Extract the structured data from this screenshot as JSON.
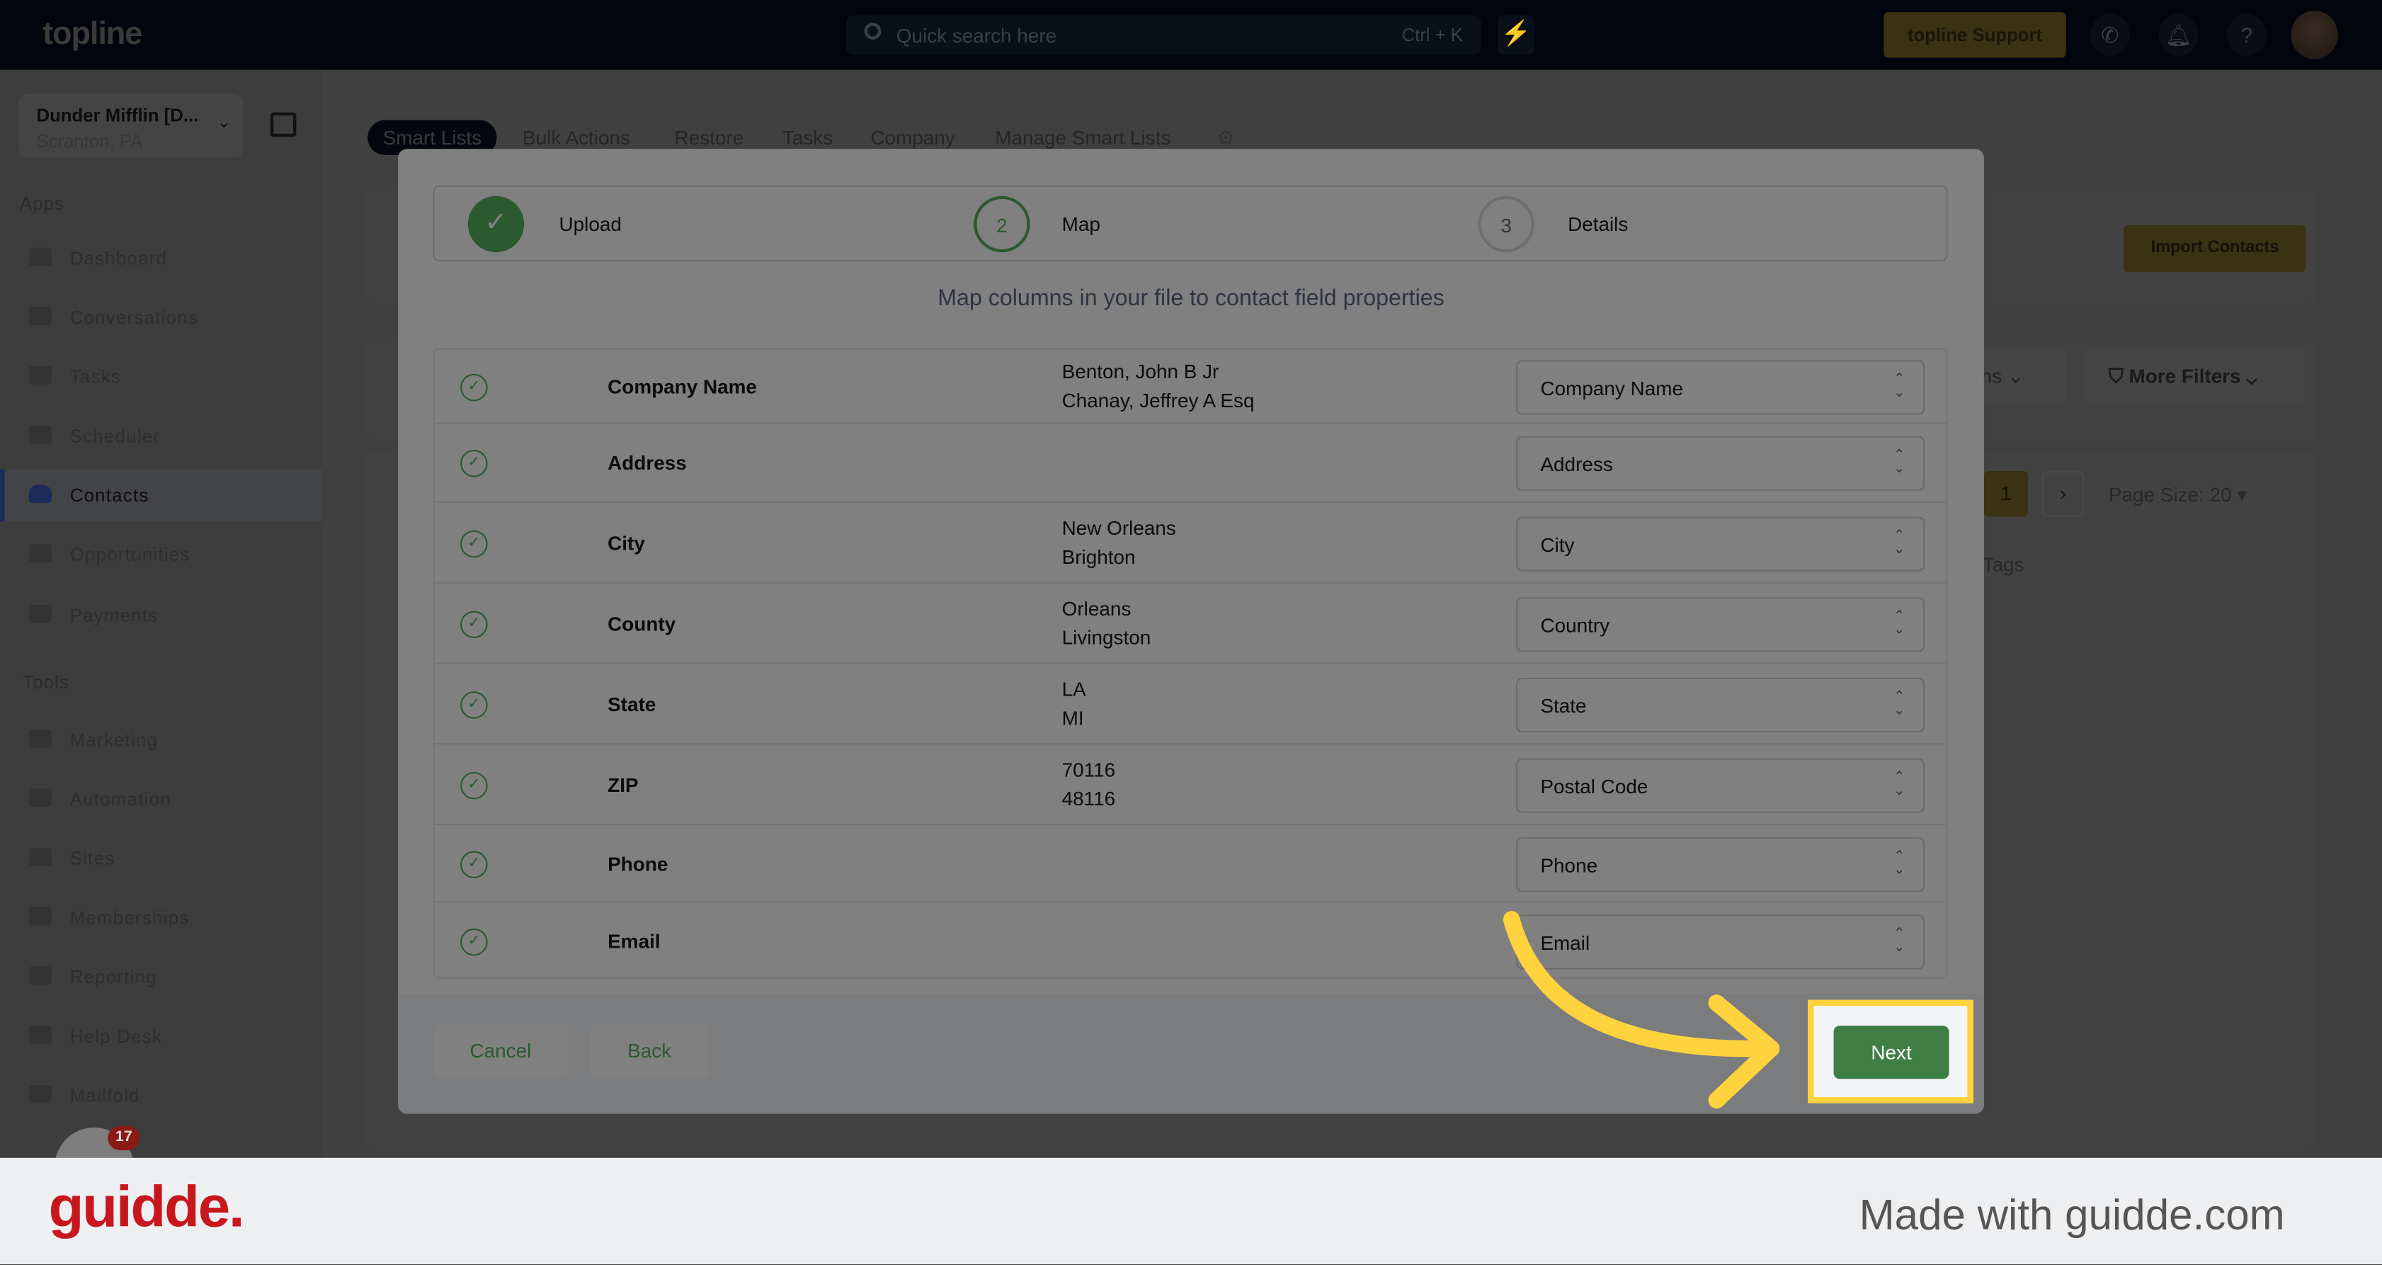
{
  "topbar": {
    "logo": "topline",
    "search_placeholder": "Quick search here",
    "search_shortcut": "Ctrl + K",
    "support_label": "topline Support"
  },
  "location": {
    "name": "Dunder Mifflin [D...",
    "city": "Scranton, PA"
  },
  "sidebar": {
    "apps_heading": "Apps",
    "tools_heading": "Tools",
    "apps": [
      {
        "label": "Dashboard",
        "icon": "dashboard-icon"
      },
      {
        "label": "Conversations",
        "icon": "chat-icon"
      },
      {
        "label": "Tasks",
        "icon": "tasks-icon"
      },
      {
        "label": "Scheduler",
        "icon": "calendar-icon"
      },
      {
        "label": "Contacts",
        "icon": "user-icon",
        "active": true
      },
      {
        "label": "Opportunities",
        "icon": "target-icon"
      },
      {
        "label": "Payments",
        "icon": "credit-card-icon"
      }
    ],
    "tools": [
      {
        "label": "Marketing",
        "icon": "megaphone-icon"
      },
      {
        "label": "Automation",
        "icon": "gears-icon"
      },
      {
        "label": "Sites",
        "icon": "globe-icon"
      },
      {
        "label": "Memberships",
        "icon": "users-icon"
      },
      {
        "label": "Reporting",
        "icon": "pie-chart-icon"
      },
      {
        "label": "Help Desk",
        "icon": "help-icon"
      },
      {
        "label": "Mailfold",
        "icon": "mail-icon"
      }
    ]
  },
  "tabs": [
    "Smart Lists",
    "Bulk Actions",
    "Restore",
    "Tasks",
    "Company",
    "Manage Smart Lists"
  ],
  "background": {
    "import_contacts": "Import Contacts",
    "columns_partial": "ns",
    "more_filters": "More Filters",
    "current_page": "1",
    "page_size": "Page Size: 20",
    "tags_header": "Tags"
  },
  "modal": {
    "steps": [
      {
        "number": "1",
        "label": "Upload",
        "status": "complete"
      },
      {
        "number": "2",
        "label": "Map",
        "status": "current"
      },
      {
        "number": "3",
        "label": "Details",
        "status": "upcoming"
      }
    ],
    "subtitle": "Map columns in your file to contact field properties",
    "rows": [
      {
        "column": "Company Name",
        "sample1": "Benton, John B Jr",
        "sample2": "Chanay, Jeffrey A Esq",
        "field": "Company Name"
      },
      {
        "column": "Address",
        "sample1": "",
        "sample2": "",
        "field": "Address"
      },
      {
        "column": "City",
        "sample1": "New Orleans",
        "sample2": "Brighton",
        "field": "City"
      },
      {
        "column": "County",
        "sample1": "Orleans",
        "sample2": "Livingston",
        "field": "Country"
      },
      {
        "column": "State",
        "sample1": "LA",
        "sample2": "MI",
        "field": "State"
      },
      {
        "column": "ZIP",
        "sample1": "70116",
        "sample2": "48116",
        "field": "Postal Code"
      },
      {
        "column": "Phone",
        "sample1": "",
        "sample2": "",
        "field": "Phone"
      },
      {
        "column": "Email",
        "sample1": "",
        "sample2": "",
        "field": "Email"
      }
    ],
    "cancel": "Cancel",
    "back": "Back",
    "next": "Next"
  },
  "chat_badge": "17",
  "footer": {
    "brand": "guidde.",
    "made_with": "Made with guidde.com"
  },
  "colors": {
    "accent_green": "#3f7f45",
    "highlight_yellow": "#ffd33d",
    "brand_red": "#c8161d"
  }
}
